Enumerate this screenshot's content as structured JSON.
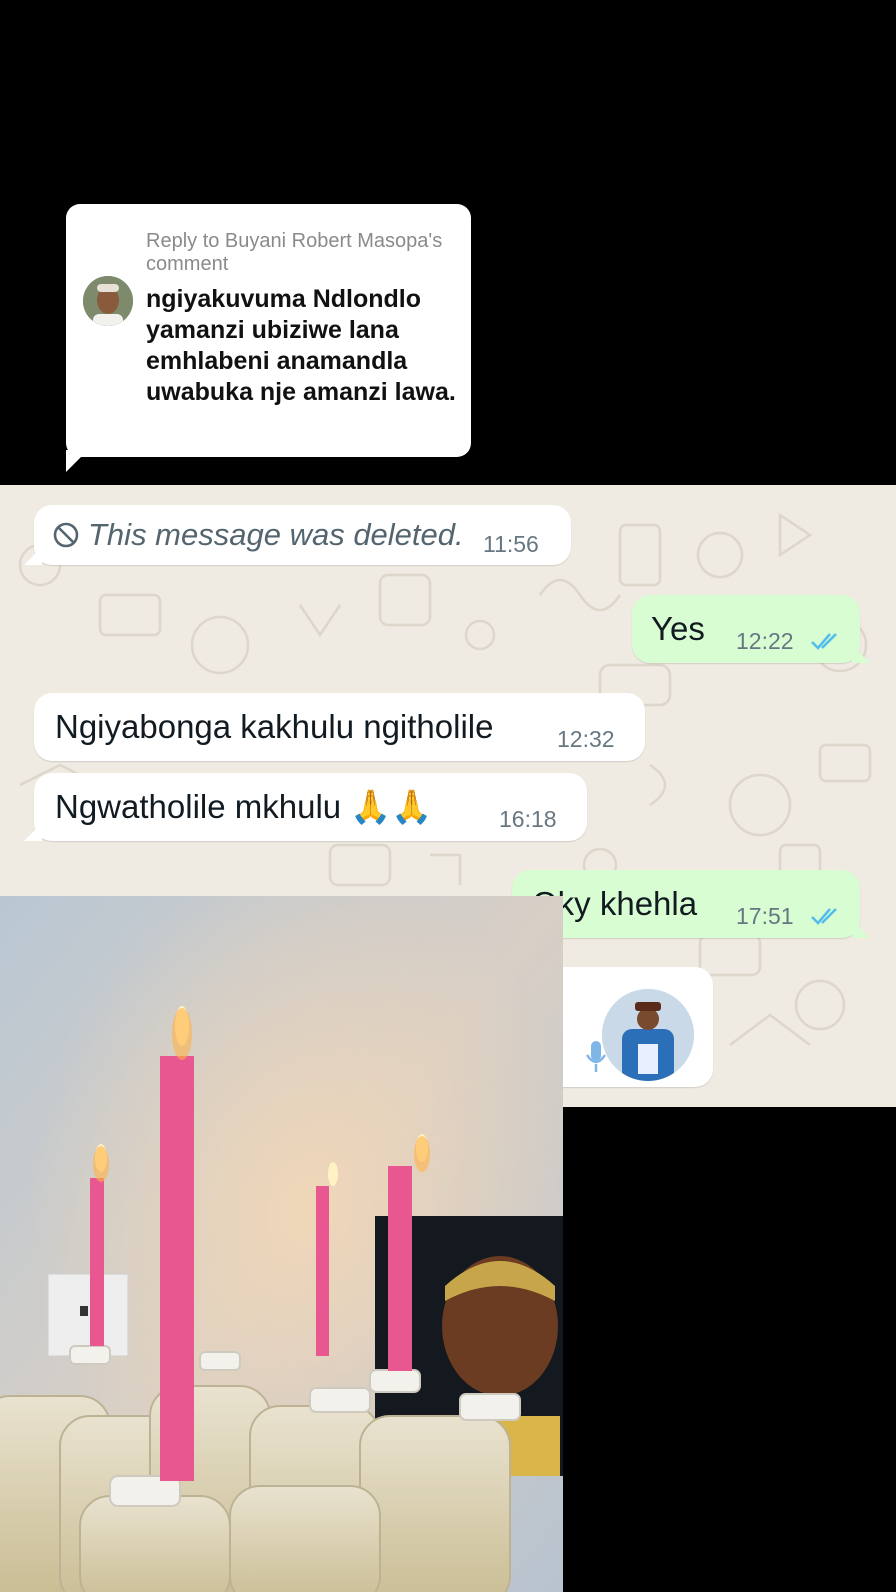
{
  "reply": {
    "header": "Reply to Buyani Robert Masopa's comment",
    "body": "ngiyakuvuma Ndlondlo yamanzi ubiziwe lana emhlabeni anamandla uwabuka nje amanzi lawa."
  },
  "messages": [
    {
      "id": "m1",
      "direction": "in",
      "text": "This message was deleted.",
      "time": "11:56",
      "deleted": true
    },
    {
      "id": "m2",
      "direction": "out",
      "text": "Yes",
      "time": "12:22"
    },
    {
      "id": "m3",
      "direction": "in",
      "text": "Ngiyabonga kakhulu ngitholile",
      "time": "12:32"
    },
    {
      "id": "m4",
      "direction": "in",
      "text": "Ngwatholile mkhulu 🙏🙏",
      "time": "16:18"
    },
    {
      "id": "m5",
      "direction": "out",
      "text": "Oky khehla",
      "time": "17:51"
    }
  ],
  "icons": {
    "deleted": "block-icon",
    "read_receipt": "double-check-icon",
    "voice": "microphone-icon"
  },
  "colors": {
    "chat_bg": "#efeae2",
    "incoming_bubble": "#ffffff",
    "outgoing_bubble": "#d9fdd3",
    "read_tick": "#53bdeb",
    "candles": "#e8578f"
  }
}
